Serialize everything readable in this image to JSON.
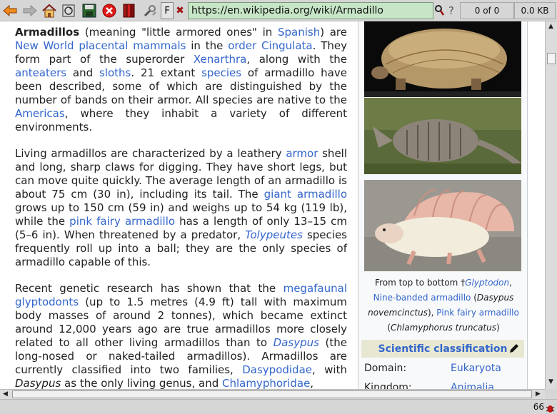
{
  "toolbar": {
    "url": "https://en.wikipedia.org/wiki/Armadillo",
    "font_button": "F",
    "close_button": "✖",
    "match_count": "0 of 0",
    "size": "0.0 KB",
    "icons": [
      "back-icon",
      "forward-icon",
      "home-icon",
      "reload-icon",
      "save-icon",
      "stop-icon",
      "bookmarks-icon",
      "settings-icon",
      "search-icon",
      "help-icon"
    ]
  },
  "article": {
    "p1": {
      "parts": [
        "Armadillos",
        " (meaning \"little armored ones\" in ",
        "Spanish",
        ") are ",
        "New World",
        " ",
        "placental mammals",
        " in the ",
        "order",
        " ",
        "Cingulata",
        ". They form part of the superorder ",
        "Xenarthra",
        ", along with the ",
        "anteaters",
        " and ",
        "sloths",
        ". 21 extant ",
        "species",
        " of armadillo have been described, some of which are distinguished by the number of bands on their armor. All species are native to the ",
        "Americas",
        ", where they inhabit a variety of different environments."
      ]
    },
    "p2": {
      "parts": [
        "Living armadillos are characterized by a leathery ",
        "armor",
        " shell and long, sharp claws for digging. They have short legs, but can move quite quickly. The average length of an armadillo is about 75 cm (30 in), including its tail. The ",
        "giant armadillo",
        " grows up to 150 cm (59 in) and weighs up to 54 kg (119 lb), while the ",
        "pink fairy armadillo",
        " has a length of only 13–15 cm (5–6 in). When threatened by a predator, ",
        "Tolypeutes",
        " species frequently roll up into a ball; they are the only species of armadillo capable of this."
      ]
    },
    "p3": {
      "parts": [
        "Recent genetic research has shown that the ",
        "megafaunal",
        " ",
        "glyptodonts",
        " (up to 1.5 metres (4.9 ft) tall with maximum body masses of around 2 tonnes), which became extinct around 12,000 years ago are true armadillos more closely related to all other living armadillos than to ",
        "Dasypus",
        " (the long-nosed or naked-tailed armadillos). Armadillos are currently classified into two families, ",
        "Dasypodidae",
        ", with ",
        "Dasypus",
        " as the only living genus, and ",
        "Chlamyphoridae",
        ","
      ]
    }
  },
  "infobox": {
    "caption": {
      "t1": "From top to bottom †",
      "glyptodon": "Glyptodon",
      "t2": ",",
      "nine_banded": "Nine-banded armadillo",
      "t3": " (",
      "dasypus_novem": "Dasypus novemcinctus",
      "t4": "), ",
      "pink_fairy": "Pink fairy armadillo",
      "t5": " (",
      "chlamyphorus": "Chlamyphorus truncatus",
      "t6": ")"
    },
    "sci_class": "Scientific classification",
    "rows": [
      {
        "label": "Domain:",
        "value": "Eukaryota"
      },
      {
        "label": "Kingdom:",
        "value": "Animalia"
      }
    ]
  },
  "status": {
    "zoom": "66"
  },
  "colors": {
    "link": "#3366cc",
    "url_bg": "#c7e6c7",
    "sci_bg": "#e8e8d2"
  }
}
